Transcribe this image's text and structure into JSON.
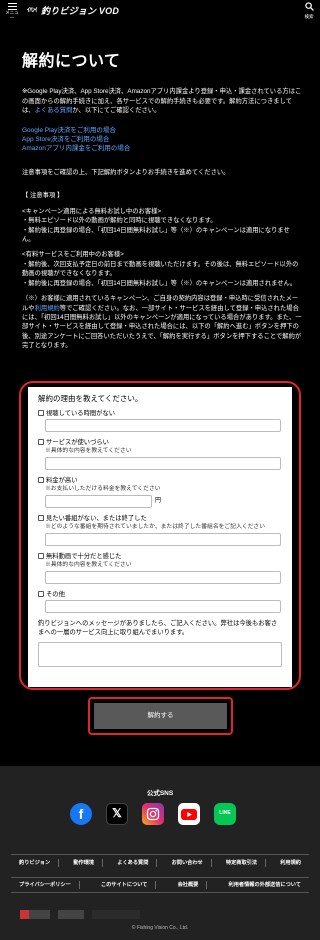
{
  "header": {
    "menu_label": "メニュー",
    "logo_mark": "ｲﾊﾝｲ",
    "logo_text": "釣りビジョン VOD",
    "search_label": "検索"
  },
  "page": {
    "title": "解約について",
    "intro": "※Google Play決済、App Store決済、Amazonアプリ内課金より登録・申込・課金されている方はこの画面からの解約手続きに加え、各サービスでの解約手続きも必要です。解約方法につきましては、",
    "intro_link": "よくある質問",
    "intro_tail": "か、以下にてご確認ください。",
    "links": [
      "Google Play決済をご利用の場合",
      "App Store決済をご利用の場合",
      "Amazonアプリ内課金をご利用の場合"
    ],
    "notice": "注意事項をご確認の上、下記解約ボタンよりお手続きを進めてください。",
    "caution_heading": "【 注意事項 】",
    "campaign_heading": "<キャンペーン適用による無料お試し中のお客様>",
    "campaign_1": "・無料エピソード以外の動画が解約と同時に視聴できなくなります。",
    "campaign_2": "・解約後に再登録の場合、「初回14日間無料お試し」等（※）のキャンペーンは適用になりません。",
    "paid_heading": "<有料サービスをご利用中のお客様>",
    "paid_1": "・解約後、次回支払予定日の前日まで動画を視聴いただけます。その後は、無料エピソード以外の動画の視聴ができなくなります。",
    "paid_2": "・解約後に再登録の場合、「初回14日間無料お試し」等（※）のキャンペーンは適用されません。",
    "note_1": "（※）お客様に適用されているキャンペーン、ご自身の契約内容は登録・申込時に受信されたメールや",
    "note_link": "利用規約",
    "note_2": "等でご確認ください。なお、一部サイト・サービスを経由して登録・申込された場合には、「初回14日間無料お試し」以外のキャンペーンが適用になっている場合があります。また、一部サイト・サービスを経由して登録・申込された場合には、以下の「解約へ進む」ボタンを押下の後、別途アンケートにご回答いただいたうえで、「解約を実行する」ボタンを押下することで解約が完了となります。"
  },
  "form": {
    "title": "解約の理由を教えてください。",
    "opt_no_time": "視聴している時間がない",
    "opt_hard_to_use": "サービスが使いづらい",
    "hint_detail_1": "※具体的な内容を教えてください",
    "opt_price": "料金が高い",
    "hint_price": "※お支払いしただける料金を教えてください",
    "currency": "円",
    "opt_no_show": "見たい番組がない、または終了した",
    "hint_show": "※どのような番組を期待されていましたか、または終了した番組名をご記入ください",
    "opt_enough": "無料動画で十分だと感じた",
    "hint_detail_2": "※具体的な内容を教えてください",
    "opt_other": "その他",
    "message_prompt": "釣りビジョンへのメッセージがありましたら、ご記入ください。弊社は今後もお客さまへの一層のサービス向上に取り組んでまいります。"
  },
  "submit_label": "解約する",
  "footer": {
    "sns_title": "公式SNS",
    "sns": [
      "facebook-icon",
      "x-icon",
      "instagram-icon",
      "youtube-icon",
      "line-icon"
    ],
    "line_label": "LINE",
    "nav_row1": [
      "釣りビジョン",
      "動作環境",
      "よくある質問",
      "お問い合わせ",
      "特定商取引法",
      "利用規約"
    ],
    "nav_row2": [
      "プライバシーポリシー",
      "このサイトについて",
      "会社概要",
      "利用者情報の外部送信について"
    ],
    "copyright": "© Fishing Vision Co., Ltd."
  },
  "colors": {
    "accent_red": "#e0262a",
    "link_blue": "#5ea7ff",
    "submit_bg": "#595959"
  }
}
